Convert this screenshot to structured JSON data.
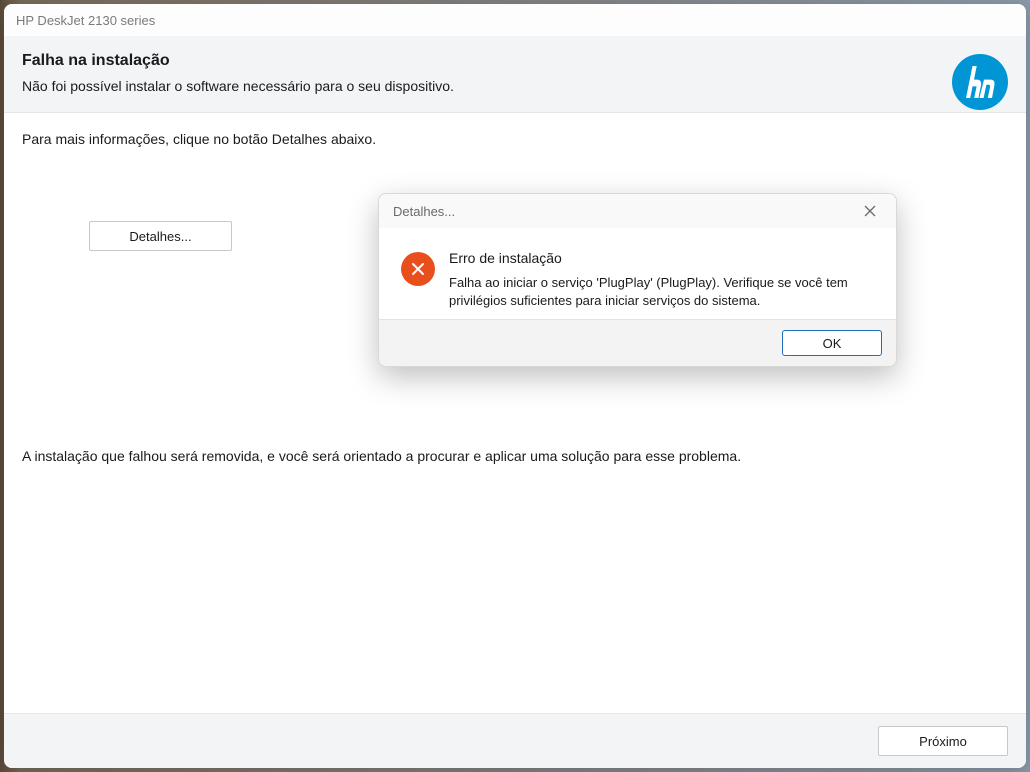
{
  "window": {
    "title": "HP DeskJet 2130 series"
  },
  "header": {
    "heading": "Falha na instalação",
    "subheading": "Não foi possível instalar o software necessário para o seu dispositivo."
  },
  "content": {
    "instruction1": "Para mais informações, clique no botão Detalhes abaixo.",
    "details_button": "Detalhes...",
    "instruction2": "A instalação que falhou será removida, e você será orientado a procurar e aplicar uma solução para esse problema."
  },
  "footer": {
    "next_button": "Próximo"
  },
  "dialog": {
    "title": "Detalhes...",
    "heading": "Erro de instalação",
    "message": "Falha ao iniciar o serviço 'PlugPlay' (PlugPlay). Verifique se você tem privilégios suficientes para iniciar serviços do sistema.",
    "ok_button": "OK"
  }
}
